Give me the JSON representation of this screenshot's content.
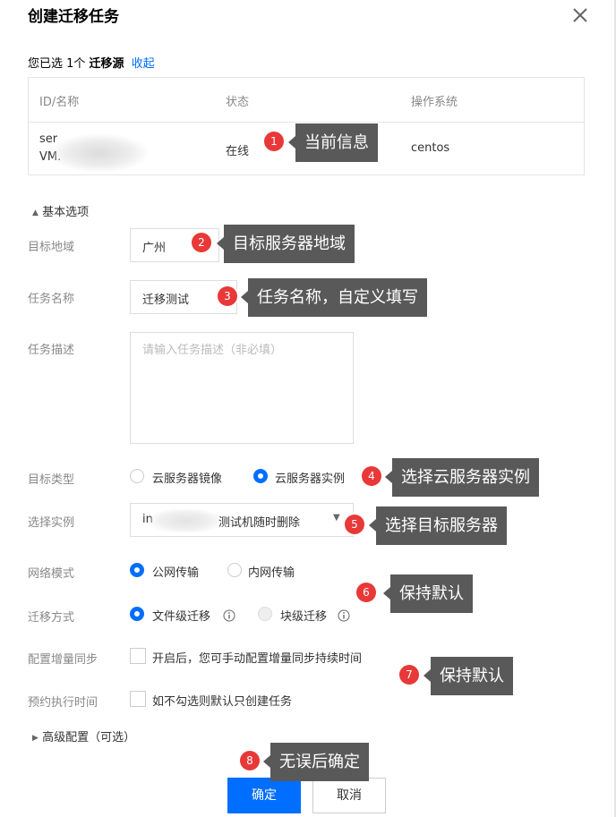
{
  "dialog": {
    "title": "创建迁移任务",
    "selected_prefix": "您已选 1个",
    "selected_source": "迁移源",
    "collapse_link": "收起"
  },
  "table": {
    "headers": [
      "ID/名称",
      "状态",
      "操作系统"
    ],
    "row": {
      "id_line1": "ser",
      "id_line2": "VM.",
      "status": "在线",
      "os": "centos"
    }
  },
  "form": {
    "basic_section": "基本选项",
    "region_label": "目标地域",
    "region_value": "广州",
    "task_name_label": "任务名称",
    "task_name_value": "迁移测试",
    "task_desc_label": "任务描述",
    "task_desc_placeholder": "请输入任务描述（非必填）",
    "target_type_label": "目标类型",
    "target_type_options": [
      "云服务器镜像",
      "云服务器实例"
    ],
    "target_type_selected": "云服务器实例",
    "instance_label": "选择实例",
    "instance_value_prefix": "in",
    "instance_value_suffix": "测试机随时删除",
    "network_label": "网络模式",
    "network_options": [
      "公网传输",
      "内网传输"
    ],
    "network_selected": "公网传输",
    "migrate_label": "迁移方式",
    "migrate_options": [
      "文件级迁移",
      "块级迁移"
    ],
    "migrate_selected": "文件级迁移",
    "incremental_label": "配置增量同步",
    "incremental_text": "开启后，您可手动配置增量同步持续时间",
    "schedule_label": "预约执行时间",
    "schedule_text": "如不勾选则默认只创建任务",
    "advanced_section": "高级配置（可选）"
  },
  "buttons": {
    "ok": "确定",
    "cancel": "取消"
  },
  "annotations": [
    {
      "num": "1",
      "text": "当前信息"
    },
    {
      "num": "2",
      "text": "目标服务器地域"
    },
    {
      "num": "3",
      "text": "任务名称，自定义填写"
    },
    {
      "num": "4",
      "text": "选择云服务器实例"
    },
    {
      "num": "5",
      "text": "选择目标服务器"
    },
    {
      "num": "6",
      "text": "保持默认"
    },
    {
      "num": "7",
      "text": "保持默认"
    },
    {
      "num": "8",
      "text": "无误后确定"
    }
  ],
  "colors": {
    "primary": "#006eff",
    "badge": "#e83838",
    "note_bg": "#595959"
  }
}
